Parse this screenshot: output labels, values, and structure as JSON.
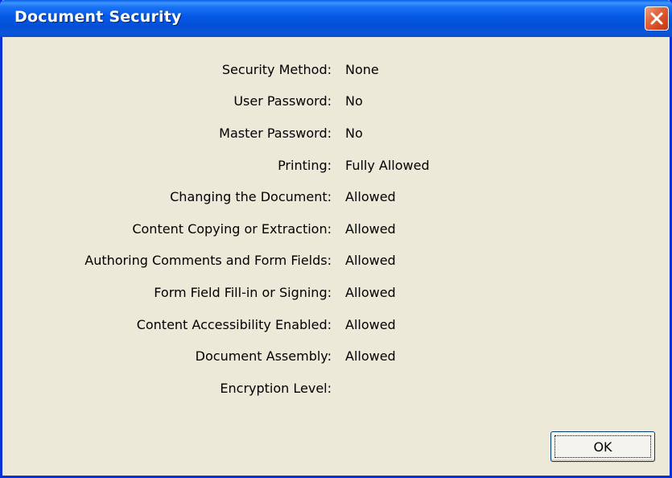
{
  "window": {
    "title": "Document Security"
  },
  "security": {
    "rows": [
      {
        "label": "Security Method:",
        "value": "None"
      },
      {
        "label": "User Password:",
        "value": "No"
      },
      {
        "label": "Master Password:",
        "value": "No"
      },
      {
        "label": "Printing:",
        "value": "Fully Allowed"
      },
      {
        "label": "Changing the Document:",
        "value": "Allowed"
      },
      {
        "label": "Content Copying or Extraction:",
        "value": "Allowed"
      },
      {
        "label": "Authoring Comments and Form Fields:",
        "value": "Allowed"
      },
      {
        "label": "Form Field Fill-in or Signing:",
        "value": "Allowed"
      },
      {
        "label": "Content Accessibility Enabled:",
        "value": "Allowed"
      },
      {
        "label": "Document Assembly:",
        "value": "Allowed"
      },
      {
        "label": "Encryption Level:",
        "value": ""
      }
    ]
  },
  "buttons": {
    "ok_label": "OK"
  },
  "colors": {
    "titlebar": "#0558e6",
    "close_button": "#d4481f",
    "dialog_background": "#ece9d8",
    "border": "#0831d9"
  },
  "icons": {
    "close": "close-icon"
  }
}
